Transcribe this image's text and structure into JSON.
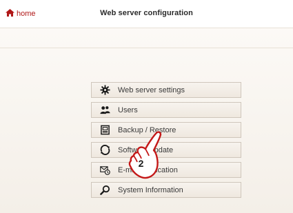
{
  "header": {
    "home_label": "home",
    "title": "Web server configuration",
    "accent_color": "#b01818"
  },
  "menu": {
    "items": [
      {
        "label": "Web server settings",
        "icon": "gear-icon"
      },
      {
        "label": "Users",
        "icon": "users-icon"
      },
      {
        "label": "Backup / Restore",
        "icon": "backup-icon"
      },
      {
        "label": "Software update",
        "icon": "update-icon"
      },
      {
        "label": "E-mail notification",
        "icon": "mail-clock-icon"
      },
      {
        "label": "System Information",
        "icon": "search-icon"
      }
    ]
  },
  "callout": {
    "number": "2"
  }
}
